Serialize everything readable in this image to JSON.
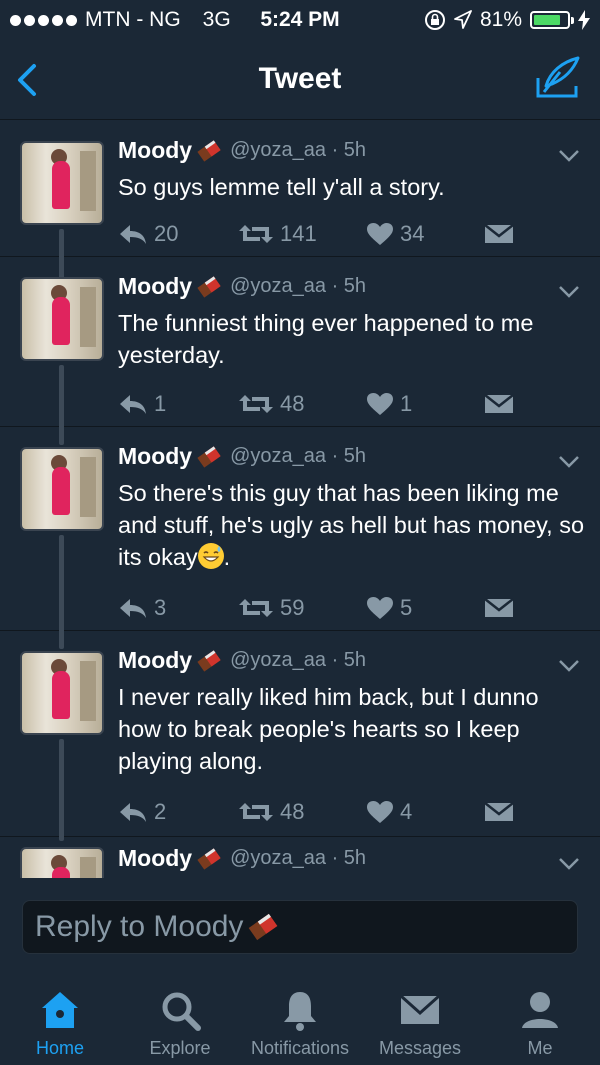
{
  "status_bar": {
    "carrier": "MTN - NG",
    "network": "3G",
    "time": "5:24 PM",
    "battery": "81%",
    "battery_level": 0.81
  },
  "nav": {
    "title": "Tweet"
  },
  "tweets": [
    {
      "name": "Moody",
      "handle": "@yoza_aa · 5h",
      "text": "So guys lemme tell y'all a story.",
      "replies": "20",
      "retweets": "141",
      "likes": "34"
    },
    {
      "name": "Moody",
      "handle": "@yoza_aa · 5h",
      "text": "The funniest thing ever happened to me yesterday.",
      "replies": "1",
      "retweets": "48",
      "likes": "1"
    },
    {
      "name": "Moody",
      "handle": "@yoza_aa · 5h",
      "text": "So there's this guy that has been liking me and stuff,  he's ugly as hell but has money,  so its okay",
      "text_suffix": ".",
      "replies": "3",
      "retweets": "59",
      "likes": "5"
    },
    {
      "name": "Moody",
      "handle": "@yoza_aa · 5h",
      "text": "I never really liked him back, but I dunno how to break people's hearts so I keep playing along.",
      "replies": "2",
      "retweets": "48",
      "likes": "4"
    },
    {
      "name": "Moody",
      "handle": "@yoza_aa · 5h"
    }
  ],
  "reply": {
    "placeholder": "Reply to Moody"
  },
  "tabs": [
    {
      "label": "Home",
      "icon": "home-icon",
      "active": true
    },
    {
      "label": "Explore",
      "icon": "search-icon",
      "active": false
    },
    {
      "label": "Notifications",
      "icon": "bell-icon",
      "active": false
    },
    {
      "label": "Messages",
      "icon": "envelope-icon",
      "active": false
    },
    {
      "label": "Me",
      "icon": "person-icon",
      "active": false
    }
  ],
  "colors": {
    "background": "#1b2836",
    "accent": "#1da1f2",
    "secondary_text": "#8899a6"
  }
}
